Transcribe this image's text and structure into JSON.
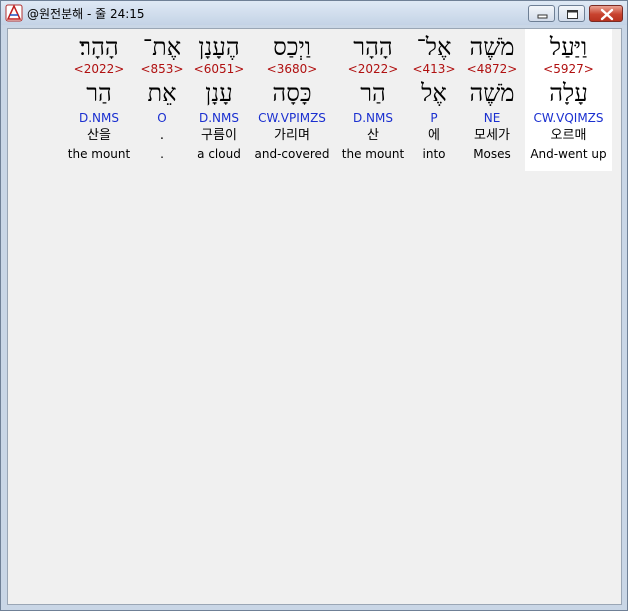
{
  "window": {
    "title": "@원전분해 - 줄 24:15"
  },
  "words": [
    {
      "hebrew": "וַיַּעַל",
      "strong": "<5927>",
      "lemma": "עָלָה",
      "parse": "CW.VQIMZS",
      "korean": "오르매",
      "english": "And-went up",
      "selected": true
    },
    {
      "hebrew": "מֹשֶׁה",
      "strong": "<4872>",
      "lemma": "מֹשֶׁה",
      "parse": "NE",
      "korean": "모세가",
      "english": "Moses",
      "selected": false
    },
    {
      "hebrew": "אֶל־",
      "strong": "<413>",
      "lemma": "אֶל",
      "parse": "P",
      "korean": "에",
      "english": "into",
      "selected": false
    },
    {
      "hebrew": "הָהָר",
      "strong": "<2022>",
      "lemma": "הַר",
      "parse": "D.NMS",
      "korean": "산",
      "english": "the mount",
      "selected": false
    },
    {
      "hebrew": "וַיְכַס",
      "strong": "<3680>",
      "lemma": "כָּסָה",
      "parse": "CW.VPIMZS",
      "korean": "가리며",
      "english": "and-covered",
      "selected": false
    },
    {
      "hebrew": "הֶעָנָן",
      "strong": "<6051>",
      "lemma": "עָנָן",
      "parse": "D.NMS",
      "korean": "구름이",
      "english": "a cloud",
      "selected": false
    },
    {
      "hebrew": "אֶת־",
      "strong": "<853>",
      "lemma": "אֵת",
      "parse": "O",
      "korean": ".",
      "english": ".",
      "selected": false
    },
    {
      "hebrew": "הָהָר׃",
      "strong": "<2022>",
      "lemma": "הַר",
      "parse": "D.NMS",
      "korean": "산을",
      "english": "the mount",
      "selected": false
    }
  ]
}
